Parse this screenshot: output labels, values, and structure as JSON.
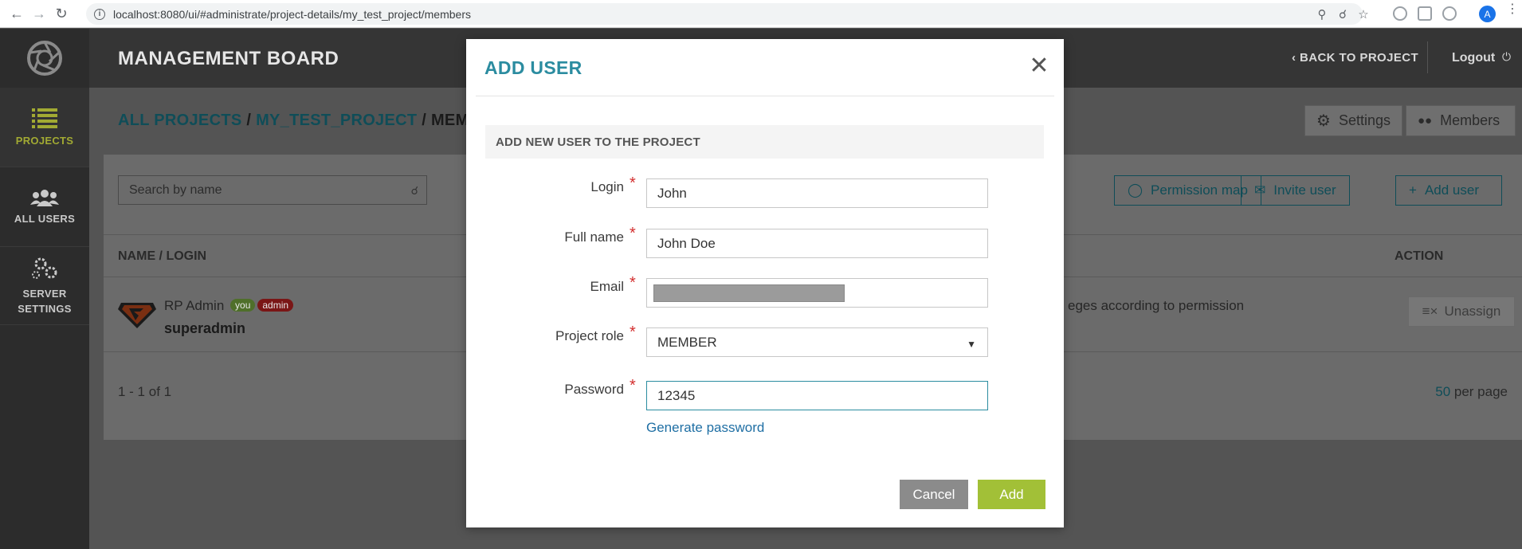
{
  "browser": {
    "url": "localhost:8080/ui/#administrate/project-details/my_test_project/members",
    "avatar_letter": "A"
  },
  "sidebar": {
    "items": [
      {
        "label": "PROJECTS",
        "icon": "list-icon",
        "active": true
      },
      {
        "label": "ALL USERS",
        "icon": "users-icon",
        "active": false
      },
      {
        "label": "SERVER SETTINGS",
        "icon": "gears-icon",
        "active": false
      }
    ]
  },
  "header": {
    "title": "MANAGEMENT BOARD",
    "back_label": "BACK TO PROJECT",
    "logout_label": "Logout"
  },
  "breadcrumb": {
    "all_projects": "ALL PROJECTS",
    "sep1": " / ",
    "project": "MY_TEST_PROJECT",
    "sep2": " / ",
    "current": "MEMBERS"
  },
  "tabs": {
    "settings": "Settings",
    "members": "Members"
  },
  "toolbar": {
    "search_placeholder": "Search by name",
    "permission_map": "Permission map",
    "invite_user": "Invite user",
    "add_user": "Add user"
  },
  "table": {
    "columns": [
      "NAME / LOGIN",
      "ACTION"
    ],
    "rows": [
      {
        "name": "RP Admin",
        "badge_you": "you",
        "badge_admin": "admin",
        "login": "superadmin",
        "permission_text": "eges according to permission",
        "action": "Unassign"
      }
    ],
    "pager": "1 - 1 of 1",
    "per_page_count": "50",
    "per_page_label": " per page"
  },
  "modal": {
    "title": "ADD USER",
    "section": "ADD NEW USER TO THE PROJECT",
    "fields": {
      "login": {
        "label": "Login",
        "value": "John"
      },
      "full_name": {
        "label": "Full name",
        "value": "John Doe"
      },
      "email": {
        "label": "Email",
        "value": ""
      },
      "project_role": {
        "label": "Project role",
        "value": "MEMBER"
      },
      "password": {
        "label": "Password",
        "value": "12345"
      }
    },
    "required_mark": "*",
    "generate_password": "Generate password",
    "cancel": "Cancel",
    "add": "Add"
  },
  "colors": {
    "accent": "#2b8ca0",
    "add_button": "#a2c037",
    "sidebar_active": "#a2aa33",
    "required": "#d32f2f"
  }
}
